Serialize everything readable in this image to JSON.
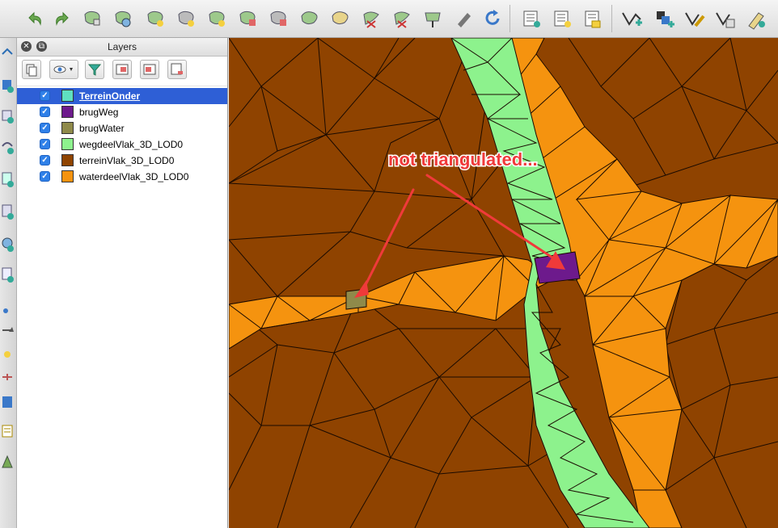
{
  "layers_panel": {
    "title": "Layers",
    "layers": [
      {
        "name": "TerreinOnder",
        "color": "#5fe0c0",
        "checked": true,
        "selected": true
      },
      {
        "name": "brugWeg",
        "color": "#6d1a8c",
        "checked": true,
        "selected": false
      },
      {
        "name": "brugWater",
        "color": "#8f8a4a",
        "checked": true,
        "selected": false
      },
      {
        "name": "wegdeelVlak_3D_LOD0",
        "color": "#8df28d",
        "checked": true,
        "selected": false
      },
      {
        "name": "terreinVlak_3D_LOD0",
        "color": "#8f4300",
        "checked": true,
        "selected": false
      },
      {
        "name": "waterdeelVlak_3D_LOD0",
        "color": "#f5930f",
        "checked": true,
        "selected": false
      }
    ]
  },
  "annotation": {
    "text": "not triangulated...",
    "color": "#f03a3a"
  },
  "colors": {
    "terrain": "#8f4300",
    "water": "#f5930f",
    "road": "#8df28d",
    "bridge_road": "#6d1a8c",
    "bridge_water": "#8f8a4a",
    "selection": "#2e5fd6"
  },
  "toolbar_icons": [
    "undo-icon",
    "redo-icon",
    "node-tool-icon",
    "rotate-feature-icon",
    "simplify-icon",
    "add-ring-icon",
    "add-part-icon",
    "fill-ring-icon",
    "delete-ring-icon",
    "delete-part-icon",
    "reshape-icon",
    "offset-curve-icon",
    "split-features-icon",
    "split-parts-icon",
    "merge-features-icon",
    "merge-attributes-icon",
    "rotate-label-icon",
    "refresh-icon",
    "toggle-edit-icon",
    "save-edits-icon",
    "add-feature-icon",
    "move-feature-icon",
    "digitize-icon",
    "vertex-editor-icon",
    "delete-selected-icon"
  ]
}
